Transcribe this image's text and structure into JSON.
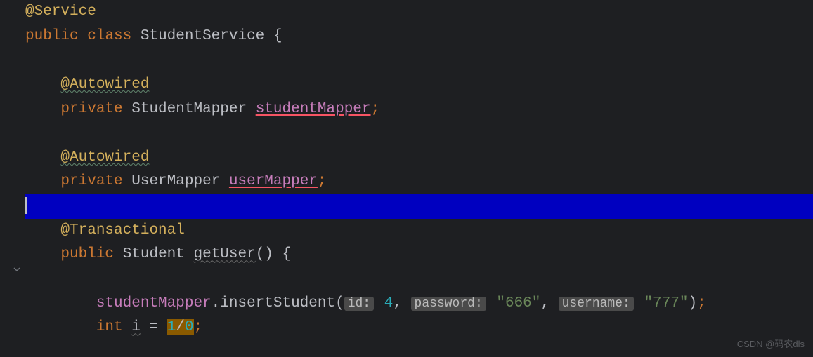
{
  "code": {
    "annotation_service": "@Service",
    "kw_public": "public",
    "kw_class": "class",
    "class_name": "StudentService",
    "annotation_autowired": "@Autowired",
    "kw_private": "private",
    "type_student_mapper": "StudentMapper",
    "field_student_mapper": "studentMapper",
    "type_user_mapper": "UserMapper",
    "field_user_mapper": "userMapper",
    "annotation_transactional": "@Transactional",
    "type_student": "Student",
    "method_get_user": "getUser",
    "method_insert_student": "insertStudent",
    "hint_id": "id:",
    "val_id": "4",
    "hint_password": "password:",
    "val_password": "\"666\"",
    "hint_username": "username:",
    "val_username": "\"777\"",
    "kw_int": "int",
    "var_i": "i",
    "expr_div_1": "1",
    "expr_div_slash": "/",
    "expr_div_0": "0"
  },
  "watermark": "CSDN @码农dls"
}
